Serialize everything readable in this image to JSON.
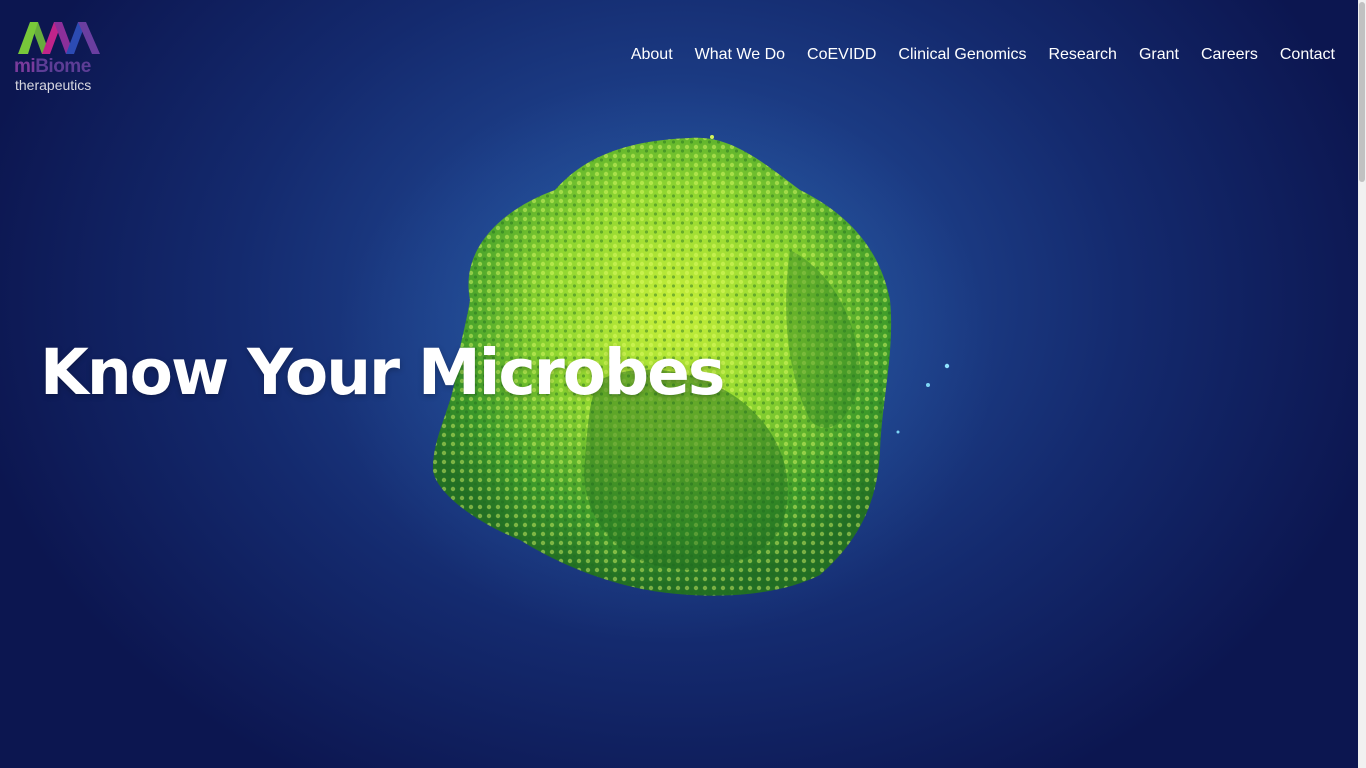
{
  "brand": {
    "name_mi": "mi",
    "name_biome": "Biome",
    "tagline": "therapeutics",
    "logo_icon": "mibiome-logo-icon",
    "colors": {
      "green": "#78c83a",
      "magenta": "#c0248a",
      "purple": "#6a3ea0",
      "blue": "#2c4bb3"
    }
  },
  "nav": {
    "items": [
      {
        "label": "About"
      },
      {
        "label": "What We Do"
      },
      {
        "label": "CoEVIDD"
      },
      {
        "label": "Clinical Genomics"
      },
      {
        "label": "Research"
      },
      {
        "label": "Grant"
      },
      {
        "label": "Careers"
      },
      {
        "label": "Contact"
      }
    ]
  },
  "hero": {
    "headline": "Know Your Microbes",
    "image": "green-microbe-cluster-image",
    "colors": {
      "background": "#1c3d86",
      "microbe_light": "#c8f03a",
      "microbe_dark": "#2f8a22"
    }
  }
}
